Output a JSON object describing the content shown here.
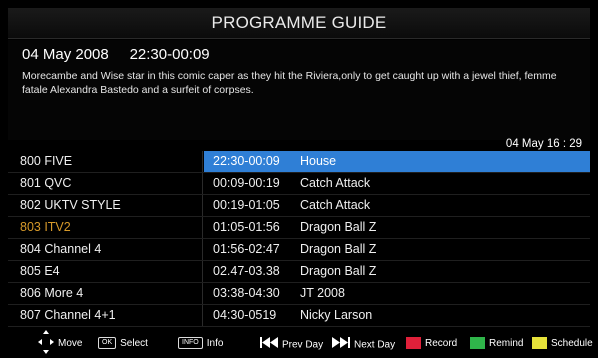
{
  "header": {
    "title": "PROGRAMME GUIDE"
  },
  "info": {
    "datetime": "04 May 2008     22:30-00:09",
    "description": "Morecambe and Wise star in this comic caper as they hit the Riviera,only to get caught up with a jewel thief, femme fatale Alexandra Bastedo and a surfeit of corpses."
  },
  "clock": "04 May 16 : 29",
  "rows": [
    {
      "channel": "800 FIVE",
      "time": "22:30-00:09",
      "programme": "House"
    },
    {
      "channel": "801 QVC",
      "time": "00:09-00:19",
      "programme": "Catch Attack"
    },
    {
      "channel": "802 UKTV STYLE",
      "time": "00:19-01:05",
      "programme": "Catch Attack"
    },
    {
      "channel": "803 ITV2",
      "time": "01:05-01:56",
      "programme": "Dragon Ball Z"
    },
    {
      "channel": "804 Channel 4",
      "time": "01:56-02:47",
      "programme": "Dragon Ball Z"
    },
    {
      "channel": "805 E4",
      "time": "02.47-03.38",
      "programme": "Dragon Ball Z"
    },
    {
      "channel": "806 More 4",
      "time": "03:38-04:30",
      "programme": "JT 2008"
    },
    {
      "channel": "807 Channel 4+1",
      "time": "04:30-0519",
      "programme": "Nicky Larson"
    }
  ],
  "footer": {
    "move": "Move",
    "ok_key": "OK",
    "select": "Select",
    "info_key": "INFO",
    "info": "Info",
    "prev_day": "Prev Day",
    "next_day": "Next Day",
    "record": "Record",
    "remind": "Remind",
    "schedule": "Schedule"
  },
  "colors": {
    "highlight": "#2f7fd6",
    "record": "#e0203a",
    "remind": "#2fb54a",
    "schedule": "#e6e23a",
    "dimmed_channel": "#d79a2a"
  },
  "icons": {
    "move": "dpad-arrows-icon",
    "prev_day": "skip-back-icon",
    "next_day": "skip-forward-icon"
  }
}
